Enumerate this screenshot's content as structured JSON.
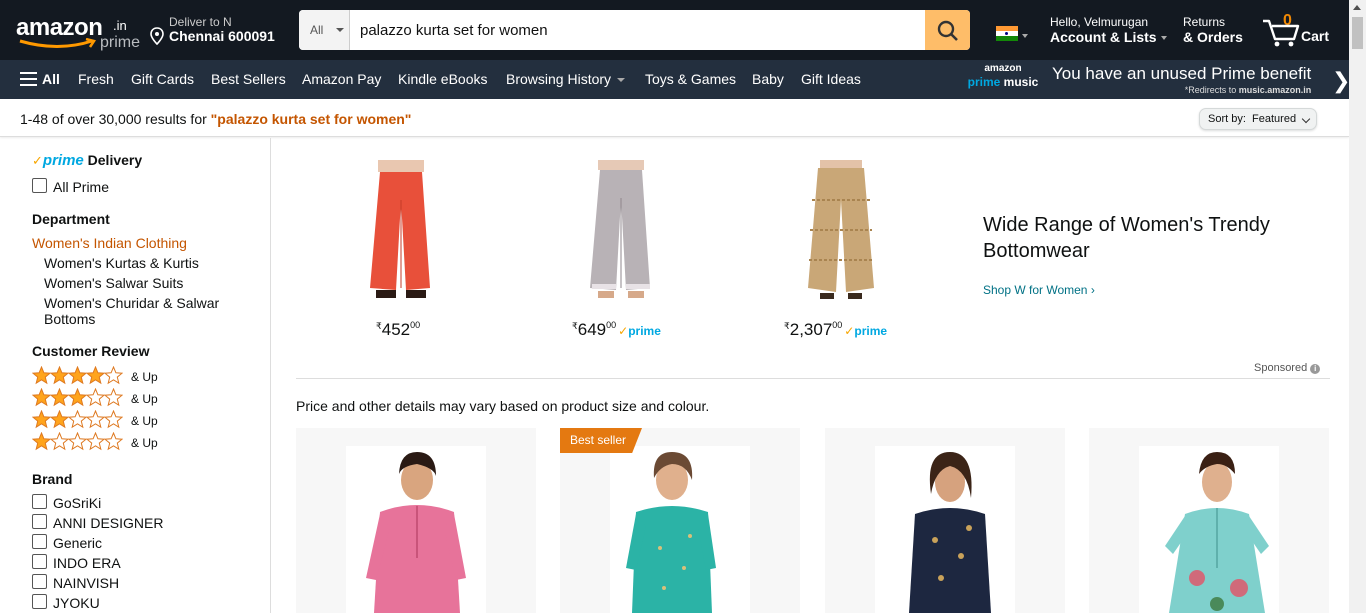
{
  "header": {
    "logo_text": "amazon",
    "logo_tld": ".in",
    "logo_sub": "prime",
    "deliver_line1": "Deliver to N",
    "deliver_line2": "Chennai 600091",
    "search_category": "All",
    "search_value": "palazzo kurta set for women",
    "account_line1": "Hello, Velmurugan",
    "account_line2": "Account & Lists",
    "returns_line1": "Returns",
    "returns_line2": "& Orders",
    "cart_count": "0",
    "cart_label": "Cart"
  },
  "nav": {
    "all": "All",
    "items": [
      "Fresh",
      "Gift Cards",
      "Best Sellers",
      "Amazon Pay",
      "Kindle eBooks",
      "Browsing History",
      "Toys & Games",
      "Baby",
      "Gift Ideas"
    ],
    "prime_music_top": "amazon",
    "prime_music_a": "prime",
    "prime_music_b": "music",
    "promo_line1": "You have an unused Prime benefit",
    "promo_line2_prefix": "*Redirects to ",
    "promo_line2_url": "music.amazon.in"
  },
  "results": {
    "summary_prefix": "1-48 of over 30,000 results for ",
    "query": "\"palazzo kurta set for women\"",
    "sort_label": "Sort by:",
    "sort_value": "Featured"
  },
  "sidebar": {
    "prime_word": "prime",
    "prime_delivery": "Delivery",
    "all_prime": "All Prime",
    "department_heading": "Department",
    "department_selected": "Women's Indian Clothing",
    "departments": [
      "Women's Kurtas & Kurtis",
      "Women's Salwar Suits",
      "Women's Churidar & Salwar",
      "Bottoms"
    ],
    "review_heading": "Customer Review",
    "review_up": "& Up",
    "ratings": [
      4,
      3,
      2,
      1
    ],
    "brand_heading": "Brand",
    "brands": [
      "GoSriKi",
      "ANNI DESIGNER",
      "Generic",
      "INDO ERA",
      "NAINVISH",
      "JYOKU"
    ]
  },
  "sponsored": {
    "products": [
      {
        "price_symbol": "₹",
        "price_whole": "452",
        "price_fraction": "00",
        "prime": false,
        "color": "#e8503a"
      },
      {
        "price_symbol": "₹",
        "price_whole": "649",
        "price_fraction": "00",
        "prime": true,
        "color": "#b8b2b6"
      },
      {
        "price_symbol": "₹",
        "price_whole": "2,307",
        "price_fraction": "00",
        "prime": true,
        "color": "#c9a777"
      }
    ],
    "prime_label": "prime",
    "title": "Wide Range of Women's Trendy Bottomwear",
    "link": "Shop W for Women",
    "sponsored_label": "Sponsored"
  },
  "listing": {
    "disclaimer": "Price and other details may vary based on product size and colour.",
    "best_seller": "Best seller",
    "cards": [
      {
        "color": "#e7739a"
      },
      {
        "color": "#2bb3a6"
      },
      {
        "color": "#1d2740"
      },
      {
        "color": "#7fd0cc"
      }
    ]
  },
  "colors": {
    "nav_dark": "#131921",
    "nav_secondary": "#232f3e",
    "search_button": "#febd69",
    "link": "#007185",
    "accent_orange": "#c45500",
    "star": "#ffa41c"
  }
}
